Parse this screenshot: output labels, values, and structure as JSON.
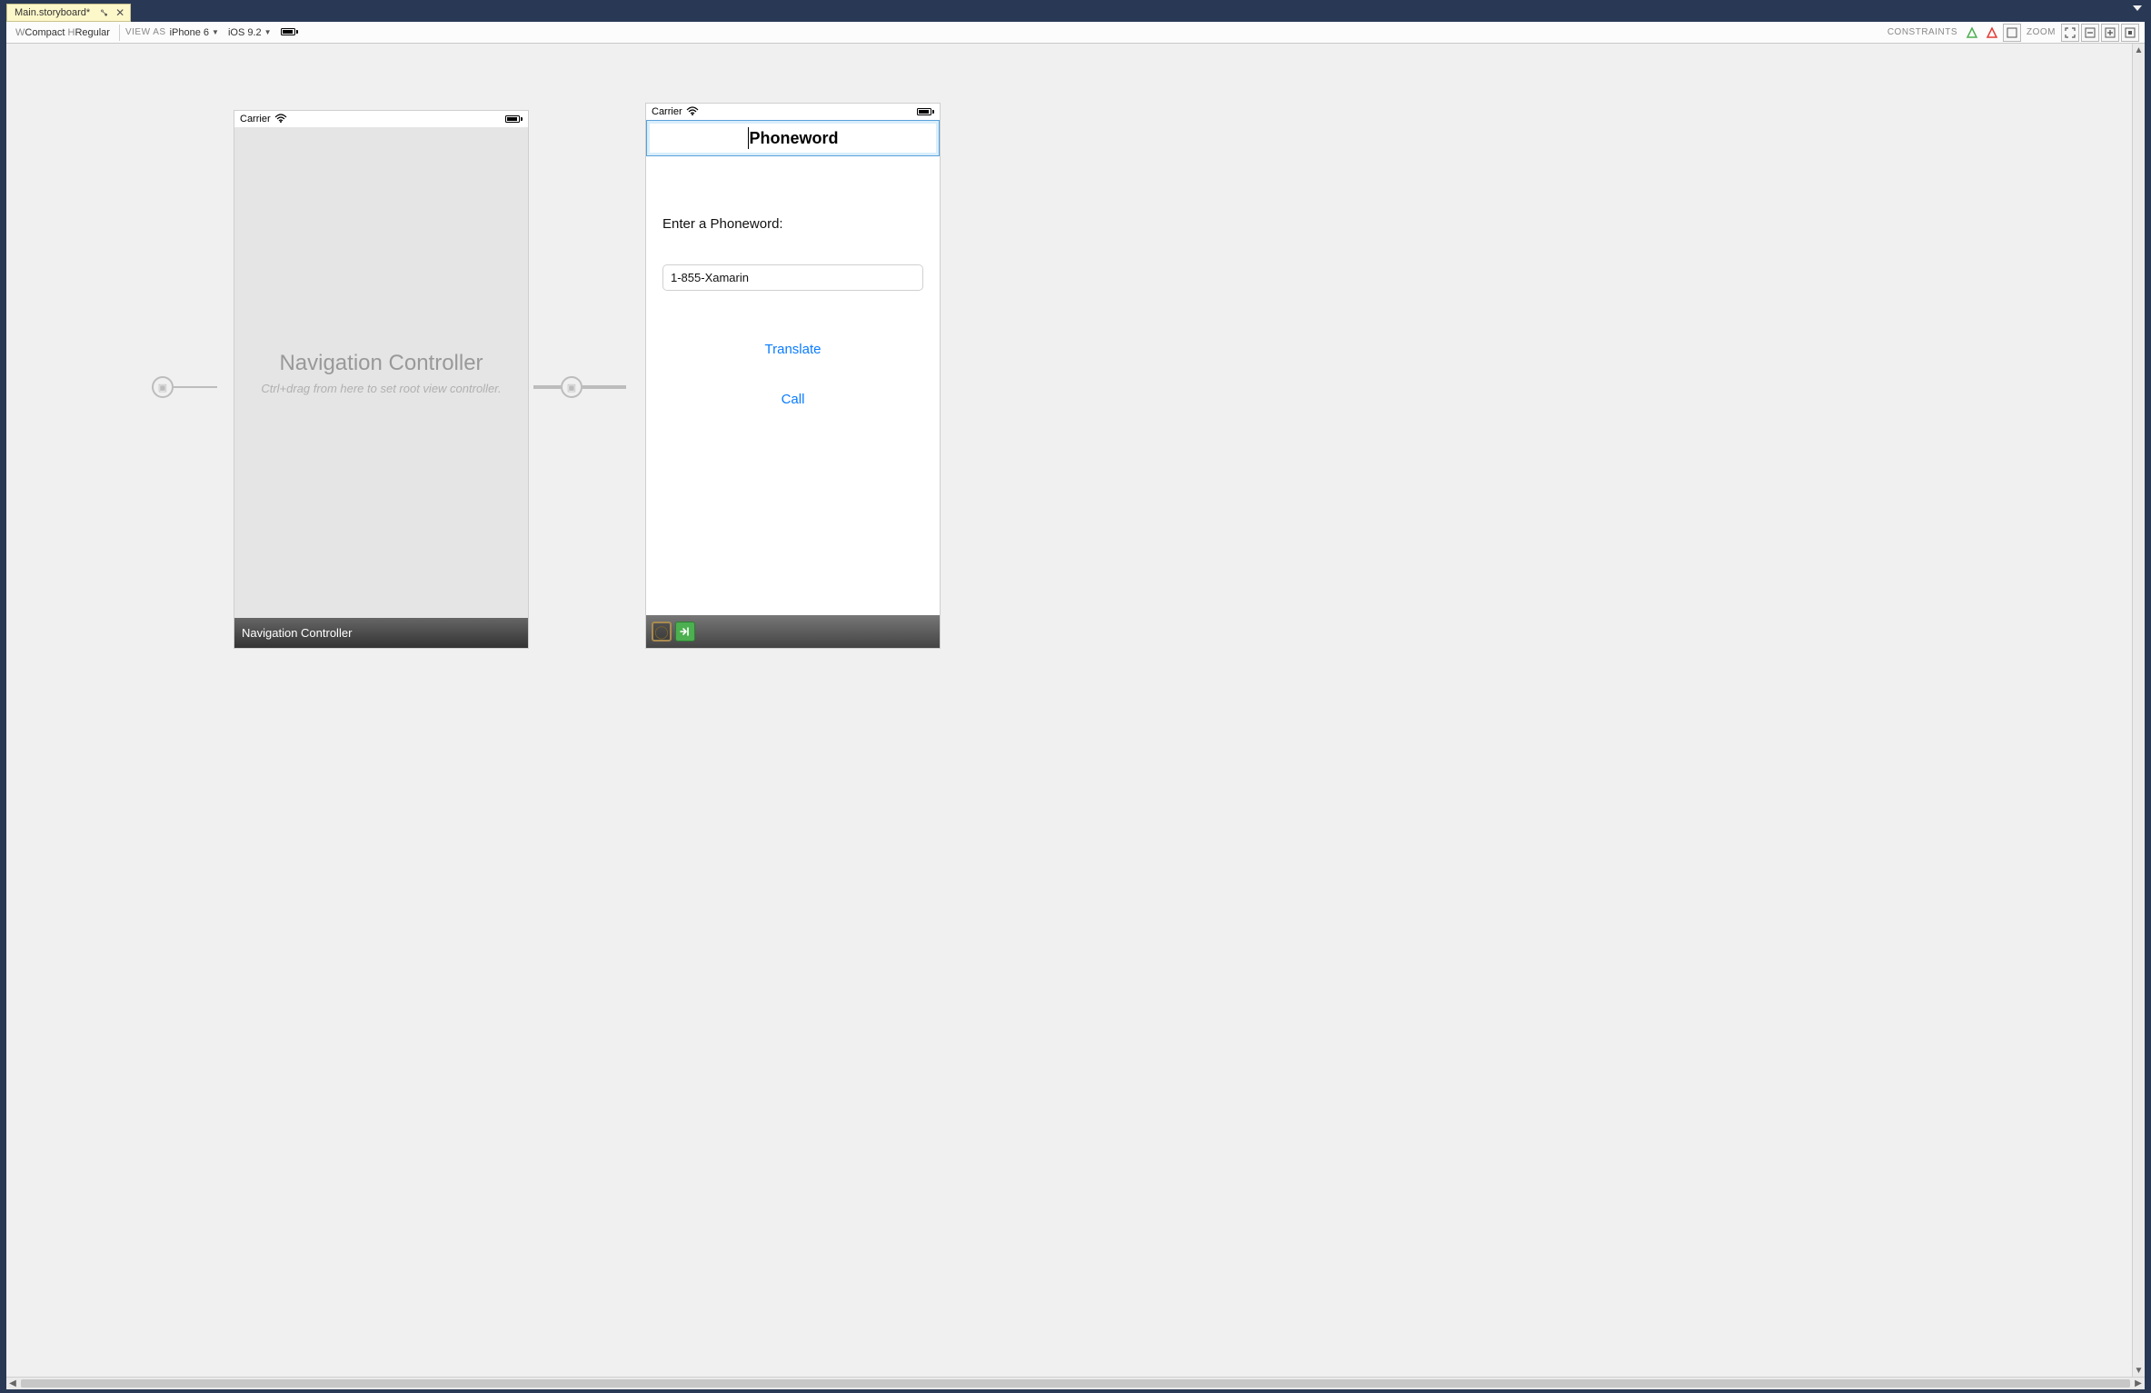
{
  "tab": {
    "title": "Main.storyboard*"
  },
  "toolbar": {
    "w_prefix": "W",
    "w_value": "Compact",
    "h_prefix": "H",
    "h_value": "Regular",
    "view_as_label": "VIEW AS",
    "device": "iPhone 6",
    "os": "iOS 9.2",
    "constraints_label": "CONSTRAINTS",
    "zoom_label": "ZOOM"
  },
  "nav_scene": {
    "carrier": "Carrier",
    "title": "Navigation Controller",
    "hint": "Ctrl+drag from here to set root view controller.",
    "footer": "Navigation Controller"
  },
  "view_scene": {
    "carrier": "Carrier",
    "navbar_title": "Phoneword",
    "label": "Enter a Phoneword:",
    "textfield_value": "1-855-Xamarin",
    "translate_button": "Translate",
    "call_button": "Call"
  }
}
